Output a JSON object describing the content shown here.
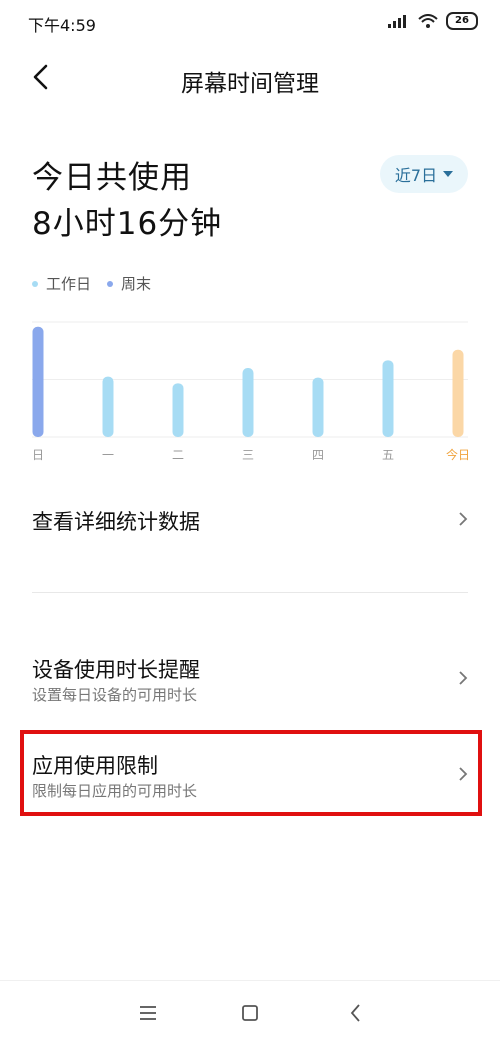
{
  "status": {
    "time": "下午4:59",
    "battery": "26"
  },
  "header": {
    "title": "屏幕时间管理"
  },
  "summary": {
    "label": "今日共使用",
    "value": "8小时16分钟",
    "range": "近7日"
  },
  "legend": {
    "weekday": "工作日",
    "weekend": "周末"
  },
  "chart_data": {
    "type": "bar",
    "categories": [
      "日",
      "一",
      "二",
      "三",
      "四",
      "五",
      "今日"
    ],
    "values": [
      115,
      63,
      56,
      72,
      62,
      80,
      91
    ],
    "kinds": [
      "weekend",
      "weekday",
      "weekday",
      "weekday",
      "weekday",
      "weekday",
      "today"
    ],
    "ylim": [
      0,
      120
    ],
    "grid": true,
    "colors": {
      "weekday": "#a7dcf4",
      "weekend": "#8aa8ec",
      "today": "#fbd7a6",
      "today_label": "#f0a33c"
    }
  },
  "menu": {
    "details": {
      "title": "查看详细统计数据"
    },
    "device_reminder": {
      "title": "设备使用时长提醒",
      "subtitle": "设置每日设备的可用时长"
    },
    "app_limit": {
      "title": "应用使用限制",
      "subtitle": "限制每日应用的可用时长"
    }
  },
  "icons": {
    "back": "chevron-left-icon",
    "row_arrow": "chevron-right-icon",
    "dropdown": "caret-down-icon"
  },
  "highlight_color": "#e01010"
}
